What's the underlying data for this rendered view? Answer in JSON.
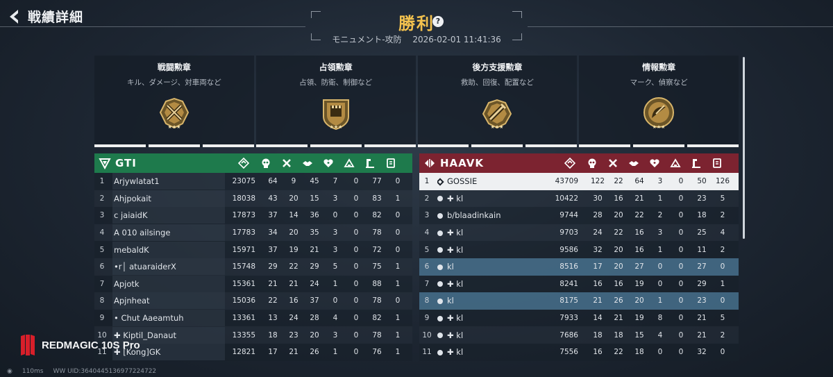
{
  "header": {
    "back_title": "戦績詳細",
    "result": "勝利",
    "help": "?",
    "mode": "モニュメント-攻防",
    "datetime": "2026-02-01 11:41:36"
  },
  "medals": [
    {
      "name": "戦闘勲章",
      "desc": "キル、ダメージ、対車両など",
      "icon": "crossed-swords-medal-icon"
    },
    {
      "name": "占領勲章",
      "desc": "占領、防衛、制御など",
      "icon": "fortress-medal-icon"
    },
    {
      "name": "後方支援勲章",
      "desc": "救助、回復、配置など",
      "icon": "syringe-medal-icon"
    },
    {
      "name": "情報勲章",
      "desc": "マーク、偵察など",
      "icon": "radar-dish-medal-icon"
    }
  ],
  "colors": {
    "team_left": "#1e7a4c",
    "team_right": "#7c2330",
    "victory": "#f2c14e",
    "highlight_row": "#46708c"
  },
  "columns": [
    "rank-icon",
    "kill-icon",
    "death-icon",
    "assist-icon",
    "revive-icon",
    "capture-icon",
    "build-icon",
    "intel-icon"
  ],
  "team_left": {
    "name": "GTI",
    "players": [
      {
        "rank": "1",
        "name": "Arjyw​latat1",
        "score": "23075",
        "stats": [
          "64",
          "9",
          "45",
          "7",
          "0",
          "77",
          "0"
        ]
      },
      {
        "rank": "2",
        "name": "Ahjpo​kait",
        "score": "18038",
        "stats": [
          "43",
          "20",
          "15",
          "3",
          "0",
          "83",
          "1"
        ]
      },
      {
        "rank": "3",
        "name": "c ​jaiaidK",
        "score": "17873",
        "stats": [
          "37",
          "14",
          "36",
          "0",
          "0",
          "82",
          "0"
        ]
      },
      {
        "rank": "4",
        "name": "A 010 ​ailsinge",
        "score": "17783",
        "stats": [
          "34",
          "20",
          "35",
          "3",
          "0",
          "78",
          "0"
        ]
      },
      {
        "rank": "5",
        "name": "​mebaldK",
        "score": "15971",
        "stats": [
          "37",
          "19",
          "21",
          "3",
          "0",
          "72",
          "0"
        ]
      },
      {
        "rank": "6",
        "name": "​•r│ ​atuaraiderX",
        "score": "15748",
        "stats": [
          "29",
          "22",
          "29",
          "5",
          "0",
          "75",
          "1"
        ]
      },
      {
        "rank": "7",
        "name": "​Apjotk",
        "score": "15361",
        "stats": [
          "21",
          "21",
          "24",
          "1",
          "0",
          "88",
          "1"
        ]
      },
      {
        "rank": "8",
        "name": "​Apjnheat",
        "score": "15036",
        "stats": [
          "22",
          "16",
          "37",
          "0",
          "0",
          "78",
          "0"
        ]
      },
      {
        "rank": "9",
        "name": "​• Chut ​Aaeamtuh",
        "score": "13361",
        "stats": [
          "13",
          "24",
          "28",
          "4",
          "0",
          "82",
          "1"
        ]
      },
      {
        "rank": "10",
        "name": "✚ Kiptil_Danaut",
        "score": "13355",
        "stats": [
          "18",
          "23",
          "20",
          "3",
          "0",
          "78",
          "1"
        ]
      },
      {
        "rank": "11",
        "name": "✚ [Kong]GK",
        "score": "12821",
        "stats": [
          "17",
          "21",
          "26",
          "1",
          "0",
          "76",
          "1"
        ]
      }
    ]
  },
  "team_right": {
    "name": "HAAVK",
    "players": [
      {
        "rank": "1",
        "name": "GOSSIE",
        "score": "43709",
        "stats": [
          "122",
          "22",
          "64",
          "3",
          "0",
          "50",
          "126"
        ],
        "self": true
      },
      {
        "rank": "2",
        "name": "✚ ​kl",
        "score": "10422",
        "stats": [
          "30",
          "16",
          "21",
          "1",
          "0",
          "23",
          "5"
        ]
      },
      {
        "rank": "3",
        "name": "​b/​blaadinkain",
        "score": "9744",
        "stats": [
          "28",
          "20",
          "22",
          "2",
          "0",
          "18",
          "2"
        ]
      },
      {
        "rank": "4",
        "name": "✚ ​kl",
        "score": "9703",
        "stats": [
          "24",
          "22",
          "16",
          "3",
          "0",
          "25",
          "4"
        ]
      },
      {
        "rank": "5",
        "name": "✚ ​kl",
        "score": "9586",
        "stats": [
          "32",
          "20",
          "16",
          "1",
          "0",
          "11",
          "2"
        ]
      },
      {
        "rank": "6",
        "name": "​kl",
        "score": "8516",
        "stats": [
          "17",
          "20",
          "27",
          "0",
          "0",
          "27",
          "0"
        ],
        "hl": true
      },
      {
        "rank": "7",
        "name": "✚ ​kl",
        "score": "8241",
        "stats": [
          "16",
          "16",
          "19",
          "0",
          "0",
          "29",
          "1"
        ]
      },
      {
        "rank": "8",
        "name": "​kl",
        "score": "8175",
        "stats": [
          "21",
          "26",
          "20",
          "1",
          "0",
          "23",
          "0"
        ],
        "hl": true
      },
      {
        "rank": "9",
        "name": "✚ ​kl",
        "score": "7933",
        "stats": [
          "14",
          "21",
          "19",
          "8",
          "0",
          "21",
          "5"
        ]
      },
      {
        "rank": "10",
        "name": "✚ ​kl",
        "score": "7686",
        "stats": [
          "18",
          "18",
          "15",
          "4",
          "0",
          "21",
          "2"
        ]
      },
      {
        "rank": "11",
        "name": "✚ ​kl",
        "score": "7556",
        "stats": [
          "16",
          "22",
          "18",
          "0",
          "0",
          "32",
          "0"
        ]
      }
    ]
  },
  "device": {
    "brand": "REDMAGIC 10S Pro",
    "ping": "110ms",
    "uid": "WW UID:3640445136977224722"
  }
}
